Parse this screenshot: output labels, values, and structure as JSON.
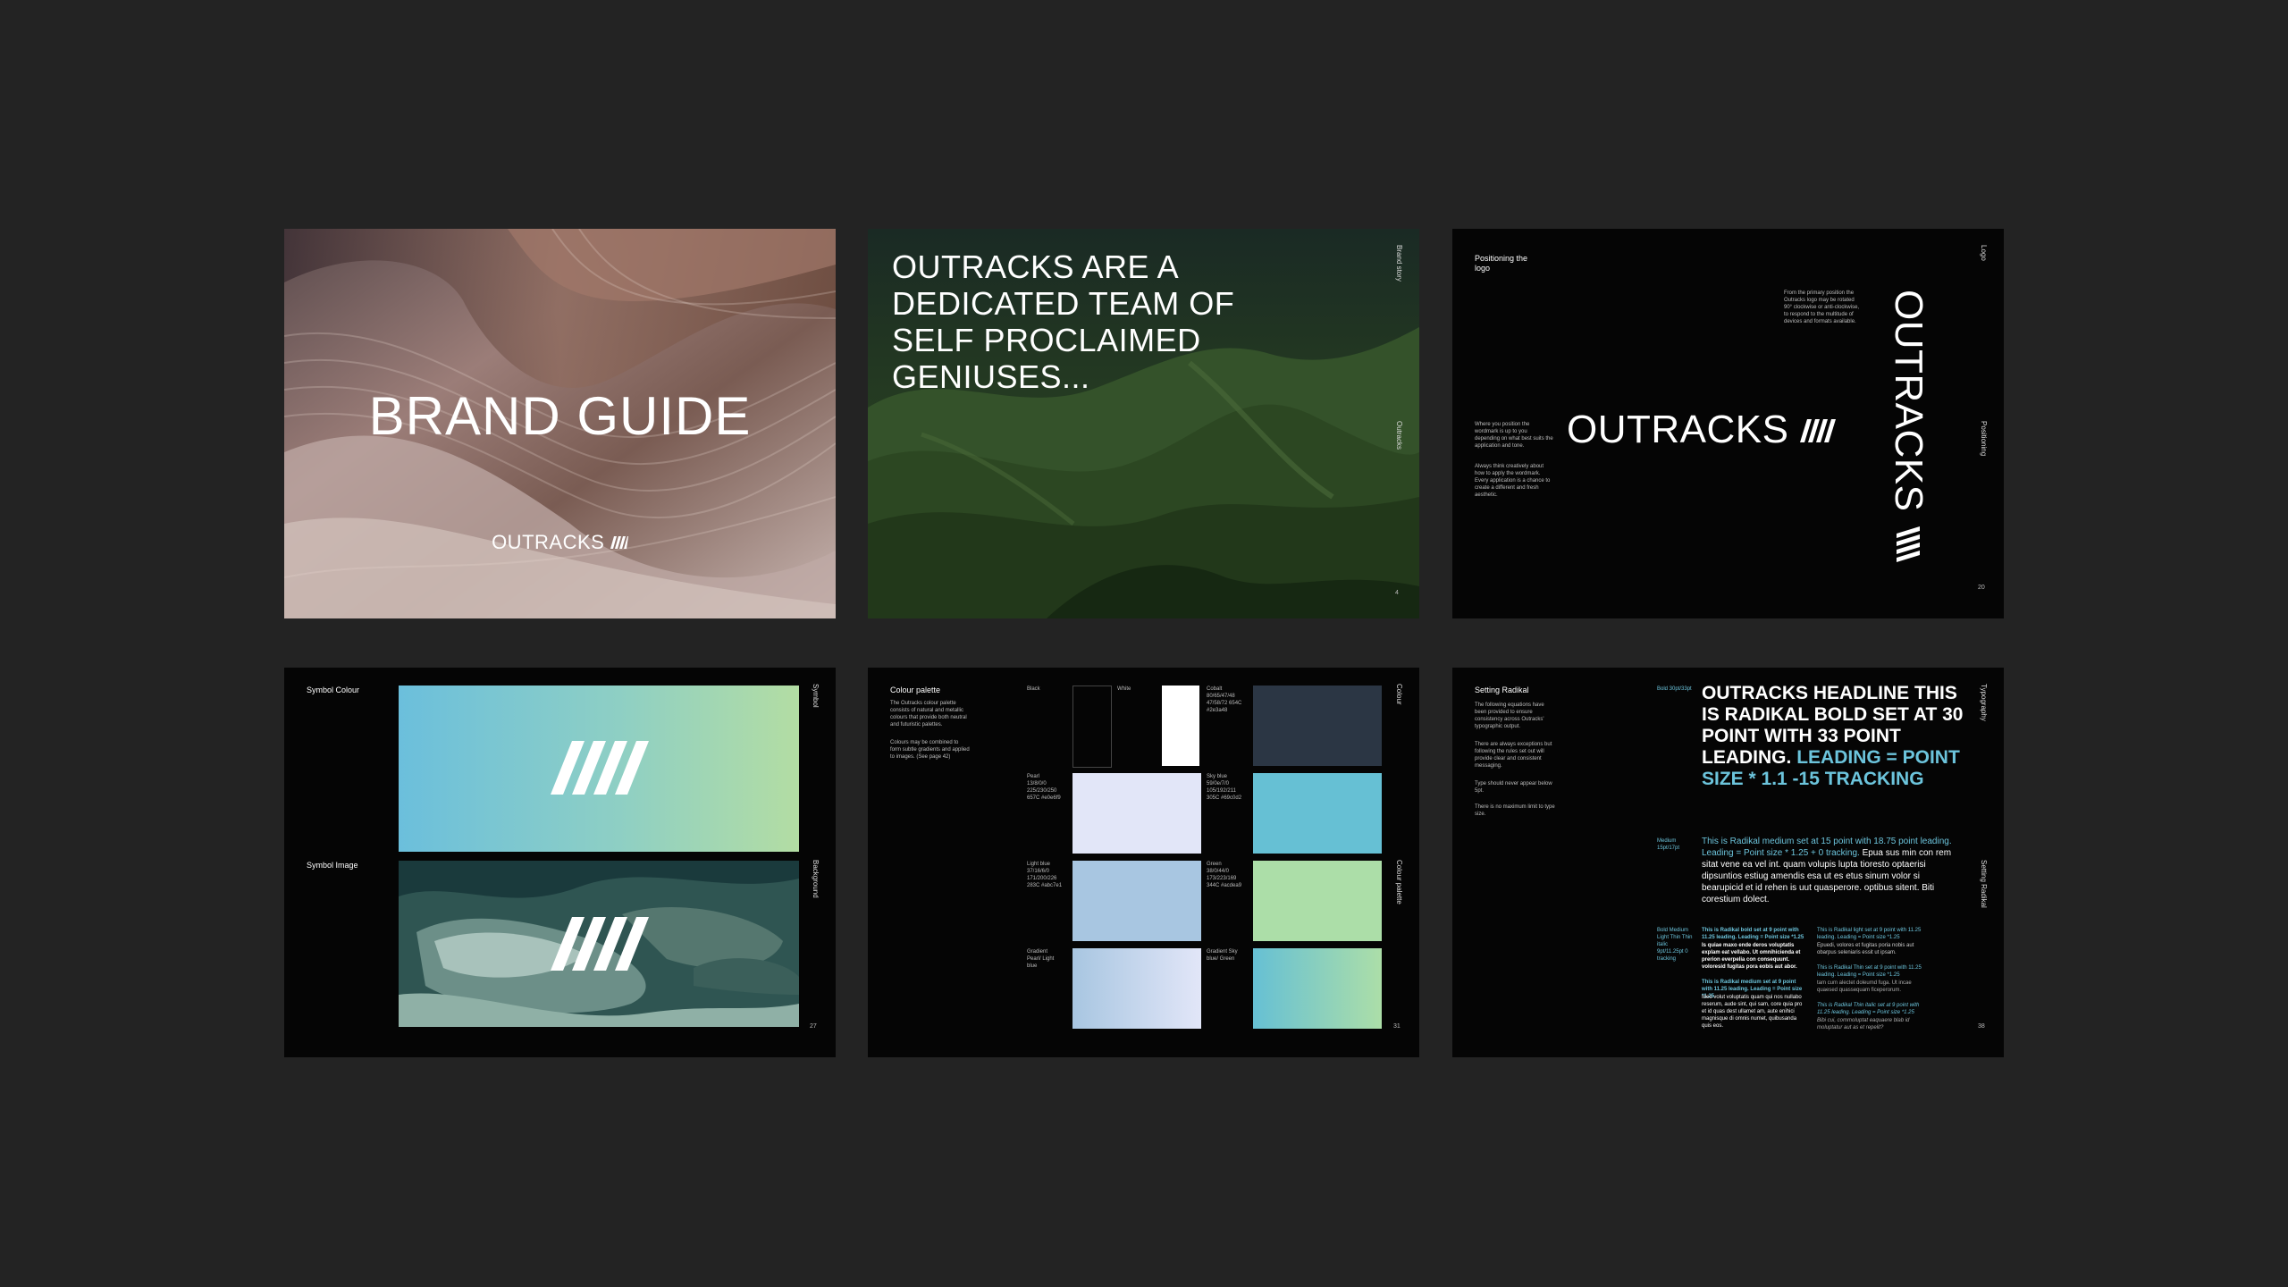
{
  "cards": {
    "brand_guide": {
      "title": "BRAND GUIDE",
      "logo": "OUTRACKS"
    },
    "dedicated_team": {
      "headline_lines": [
        "OUTRACKS ARE A",
        "DEDICATED TEAM OF",
        "SELF PROCLAIMED",
        "GENIUSES..."
      ],
      "side_top": "Brand story",
      "side_mid": "Outracks",
      "page": "4"
    },
    "positioning": {
      "heading": "Positioning the logo",
      "desc_right": "From the primary position the Outracks logo may be rotated 90° clockwise or anti-clockwise, to respond to the multitude of devices and formats available.",
      "desc_left_1": "Where you position the wordmark is up to you depending on what best suits the application and tone.",
      "desc_left_2": "Always think creatively about how to apply the wordmark. Every application is a chance to create a different and fresh aesthetic.",
      "logo_h": "OUTRACKS",
      "logo_v": "OUTRACKS",
      "side_top": "Logo",
      "side_mid": "Positioning",
      "page": "20"
    },
    "symbol": {
      "label_colour": "Symbol Colour",
      "label_image": "Symbol Image",
      "side_top": "Symbol",
      "side_mid": "Background",
      "page": "27"
    },
    "colour_palette": {
      "heading": "Colour palette",
      "desc_1": "The Outracks colour palette consists of natural and metallic colours that provide both neutral and futuristic palettes.",
      "desc_2": "Colours may be combined to form subtle gradients and applied to images. (See page 42)",
      "side_top": "Colour",
      "side_mid": "Colour palette",
      "page": "31",
      "swatches": [
        {
          "name": "Black",
          "info": "",
          "color": "#050505"
        },
        {
          "name": "White",
          "info": "",
          "color": "#ffffff"
        },
        {
          "name": "Cobalt",
          "info": "80/65/47/48 47/58/72 654C #2e3a48",
          "color": "#2b3644"
        },
        {
          "name": "Pearl",
          "info": "13/8/0/0 225/230/250 657C #e0e6f9",
          "color": "#e2e6f8"
        },
        {
          "name": "Sky blue",
          "info": "59/0e/7/0 105/192/211 305C #69c0d2",
          "color": "#66c0d4"
        },
        {
          "name": "Light blue",
          "info": "37/16/6/0 171/200/226 283C #abc7e1",
          "color": "#a8c6e1"
        },
        {
          "name": "Green",
          "info": "38/0/44/0 173/223/169 344C #acdea9",
          "color": "#acdea8"
        },
        {
          "name": "Gradient Pearl/ Light blue",
          "info": "",
          "color": "gradient-pearl"
        },
        {
          "name": "Gradient Sky blue/ Green",
          "info": "",
          "color": "gradient-green"
        }
      ]
    },
    "typography": {
      "heading": "Setting Radikal",
      "desc_1": "The following equations have been provided to ensure consistency across Outracks' typographic output.",
      "desc_2": "There are always exceptions but following the rules set out will provide clear and consistent messaging.",
      "desc_3": "Type should never appear below 5pt.",
      "desc_4": "There is no maximum limit to type size.",
      "label_bold": "Bold 30pt/33pt",
      "headline_white": "OUTRACKS HEADLINE THIS IS RADIKAL BOLD SET AT 30 POINT WITH 33 POINT LEADING.",
      "headline_blue": "LEADING = POINT SIZE * 1.1 -15 TRACKING",
      "label_medium": "Medium 15pt/17pt",
      "para_blue": "This is Radikal medium set at 15 point with 18.75 point leading. Leading = Point size * 1.25 + 0 tracking.",
      "para_white": "Epua sus min con rem sitat vene ea vel int. quam volupis lupta tioresto optaerisi dipsuntios estiug amendis esa ut es etus sinum volor si bearupicid et id rehen is uut quasperore. optibus sitent. Biti corestium dolect.",
      "label_weights": "Bold Medium Light Thin Thin italic 9pt/11.25pt 0 tracking",
      "small_bold_1": "This is Radikal bold set at 9 point with 11.25 leading. Leading = Point size *1.25",
      "small_bold_2": "Is quiae maxo ende deros voluptatis explam eat vellabo. Ut omnihicienda et prerion everpelia con consequunt. voloresid fugitas pora eobis aut abor.",
      "small_med_1": "This is Radikal medium set at 9 point with 11.25 leading. Leading = Point size *1.25",
      "small_med_2": "Ideo volut voluptatis quam qui nos nullabo reserum, aude sint, qui sam, core quia pro et id quas dest ullamet am, aute enihici magnisque di omnis numet, quibusanda quis eos.",
      "small_light_1": "This is Radikal light set at 9 point with 11.25 leading. Leading = Point size *1.25",
      "small_light_2": "Epuedi, volores et fugitas poria nobis aut obarpus seleniaris essit ut ipsam.",
      "small_thin_1": "This is Radikal Thin set at 9 point with 11.25 leading. Leading = Point size *1.25",
      "small_thin_2": "tam cum alectet doleumd fuga. Ut incae quaesed quassequam ficeperorum.",
      "small_thin_it_1": "This is Radikal Thin italic set at 9 point with 11.25 leading. Leading = Point size *1.25",
      "small_thin_it_2": "Bibi cui, commoluptat eaquaere blab id moluptatur aut as et repelit?",
      "side_top": "Typography",
      "side_mid": "Setting Radikal",
      "page": "38"
    }
  }
}
